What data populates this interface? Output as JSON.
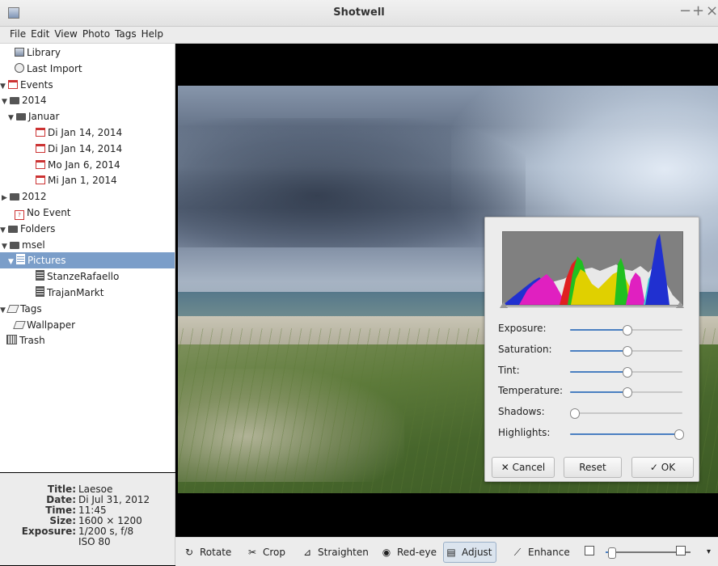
{
  "window": {
    "title": "Shotwell",
    "minimize": "−",
    "maximize": "+",
    "close": "×"
  },
  "menu": [
    "File",
    "Edit",
    "View",
    "Photo",
    "Tags",
    "Help"
  ],
  "sidebar": {
    "items": [
      {
        "label": "Library",
        "icon": "library-icon",
        "expander": ""
      },
      {
        "label": "Last Import",
        "icon": "clock-icon",
        "expander": ""
      },
      {
        "label": "Events",
        "icon": "events-icon",
        "expander": "▼"
      },
      {
        "label": "2014",
        "icon": "folder-icon",
        "expander": "▼"
      },
      {
        "label": "Januar",
        "icon": "folder-icon",
        "expander": "▼"
      },
      {
        "label": "Di Jan 14, 2014",
        "icon": "event-icon",
        "expander": ""
      },
      {
        "label": "Di Jan 14, 2014",
        "icon": "event-icon",
        "expander": ""
      },
      {
        "label": "Mo Jan 6, 2014",
        "icon": "event-icon",
        "expander": ""
      },
      {
        "label": "Mi Jan 1, 2014",
        "icon": "event-icon",
        "expander": ""
      },
      {
        "label": "2012",
        "icon": "folder-icon",
        "expander": "▶"
      },
      {
        "label": "No Event",
        "icon": "no-event-icon",
        "expander": ""
      },
      {
        "label": "Folders",
        "icon": "folder-icon",
        "expander": "▼"
      },
      {
        "label": "msel",
        "icon": "folder-icon",
        "expander": "▼"
      },
      {
        "label": "Pictures",
        "icon": "document-icon",
        "expander": "▼",
        "selected": true
      },
      {
        "label": "StanzeRafaello",
        "icon": "document-icon",
        "expander": ""
      },
      {
        "label": "TrajanMarkt",
        "icon": "document-icon",
        "expander": ""
      },
      {
        "label": "Tags",
        "icon": "tag-icon",
        "expander": "▼"
      },
      {
        "label": "Wallpaper",
        "icon": "tag-icon",
        "expander": ""
      },
      {
        "label": "Trash",
        "icon": "trash-icon",
        "expander": ""
      }
    ]
  },
  "info": [
    {
      "key": "Title:",
      "value": "Laesoe"
    },
    {
      "key": "Date:",
      "value": "Di Jul 31, 2012"
    },
    {
      "key": "Time:",
      "value": "11:45"
    },
    {
      "key": "Size:",
      "value": "1600 × 1200"
    },
    {
      "key": "Exposure:",
      "value": "1/200 s, f/8"
    },
    {
      "key": "",
      "value": "ISO 80"
    }
  ],
  "toolbar": {
    "rotate": "Rotate",
    "crop": "Crop",
    "straighten": "Straighten",
    "redeye": "Red-eye",
    "adjust": "Adjust",
    "enhance": "Enhance",
    "zoom_level": 0.03,
    "more": "▾"
  },
  "adjust": {
    "sliders": [
      {
        "label": "Exposure:",
        "value": 0.5
      },
      {
        "label": "Saturation:",
        "value": 0.5
      },
      {
        "label": "Tint:",
        "value": 0.5
      },
      {
        "label": "Temperature:",
        "value": 0.5
      },
      {
        "label": "Shadows:",
        "value": 0.0
      },
      {
        "label": "Highlights:",
        "value": 1.0
      }
    ],
    "cancel": "✕ Cancel",
    "reset": "Reset",
    "ok": "✓ OK"
  },
  "colors": {
    "accent": "#4a7fc1",
    "selection": "#7b9ec9"
  }
}
